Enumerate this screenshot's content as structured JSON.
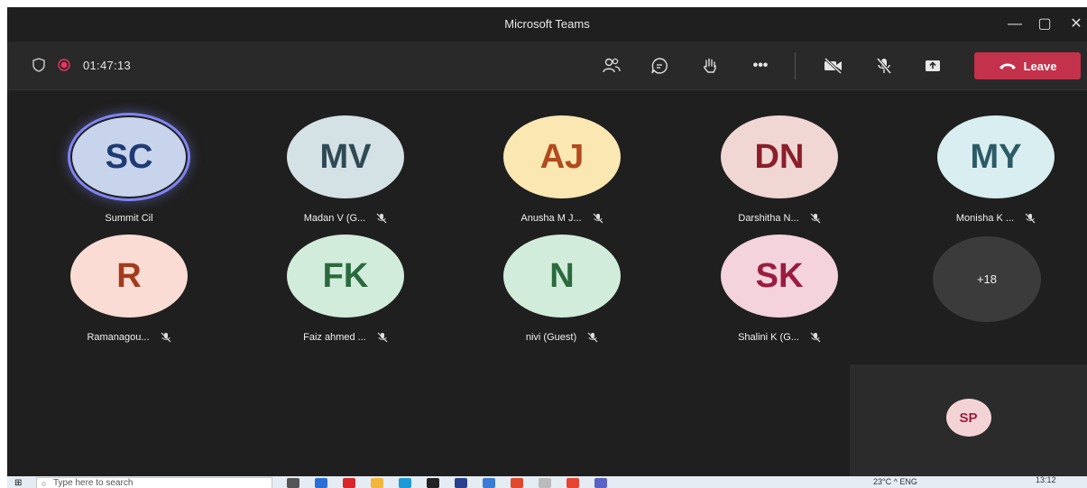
{
  "window": {
    "title": "Microsoft Teams"
  },
  "toolbar": {
    "timer": "01:47:13",
    "leave_label": "Leave"
  },
  "participants": [
    {
      "initials": "SC",
      "name": "Summit Cil",
      "bg": "#c7d4ec",
      "fg": "#1f3b73",
      "speaking": true,
      "muted": false
    },
    {
      "initials": "MV",
      "name": "Madan V (G...",
      "bg": "#d4e1e5",
      "fg": "#2f4a55",
      "muted": true
    },
    {
      "initials": "AJ",
      "name": "Anusha M J...",
      "bg": "#fbe7b2",
      "fg": "#b14a1c",
      "muted": true
    },
    {
      "initials": "DN",
      "name": "Darshitha N...",
      "bg": "#f0d7d4",
      "fg": "#8a1f2a",
      "muted": true
    },
    {
      "initials": "MY",
      "name": "Monisha K ...",
      "bg": "#d9eef0",
      "fg": "#2c5a66",
      "muted": true
    },
    {
      "initials": "R",
      "name": "Ramanagou...",
      "bg": "#fbdcd4",
      "fg": "#a33a1d",
      "muted": true
    },
    {
      "initials": "FK",
      "name": "Faiz ahmed ...",
      "bg": "#d2ecdb",
      "fg": "#2b6a3e",
      "muted": true
    },
    {
      "initials": "N",
      "name": "nivi (Guest)",
      "bg": "#d2ecdb",
      "fg": "#2b6a3e",
      "muted": true
    },
    {
      "initials": "SK",
      "name": "Shalini K (G...",
      "bg": "#f4d3dd",
      "fg": "#9b1c3f",
      "muted": true
    }
  ],
  "overflow": {
    "label": "+18"
  },
  "self_view": {
    "initials": "SP",
    "bg": "#f4d3d6",
    "fg": "#9b1c3f"
  },
  "taskbar": {
    "search_placeholder": "Type here to search",
    "clock": "13:12",
    "tray": "23°C  ^  ENG"
  }
}
